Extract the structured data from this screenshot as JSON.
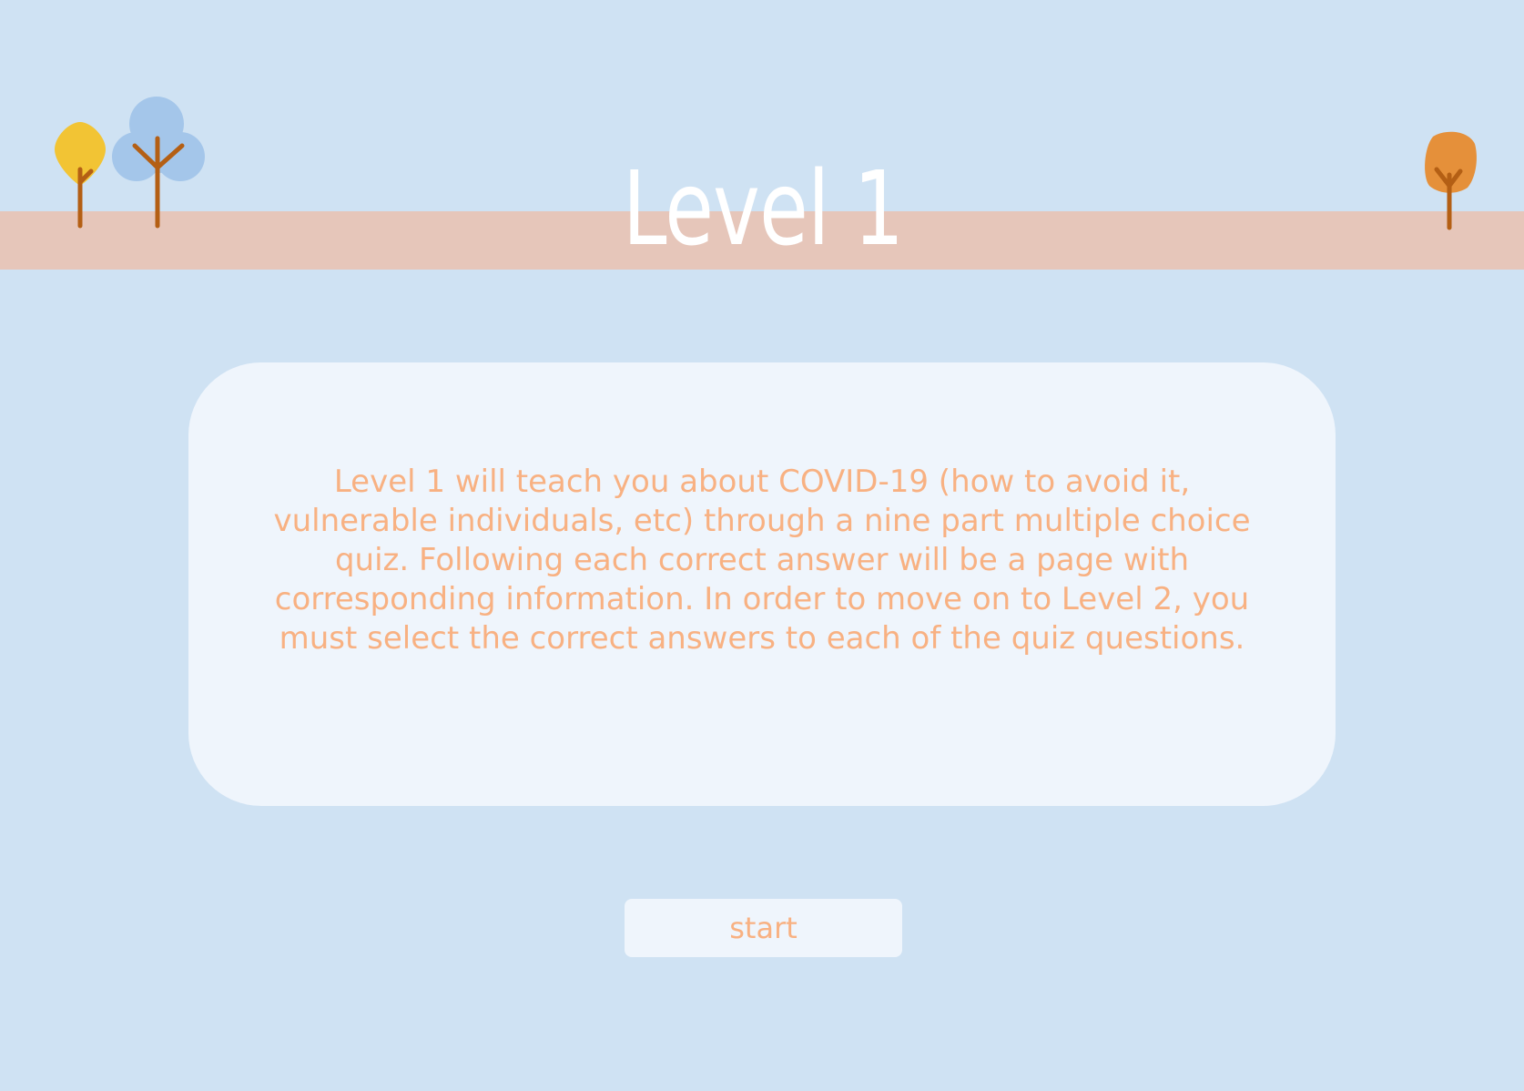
{
  "level": {
    "title": "Level 1",
    "description": "Level 1 will teach you about COVID-19 (how to avoid it, vulnerable individuals, etc) through a nine part multiple choice quiz. Following each correct answer will be a page with corresponding information. In order to move on to Level 2, you must select the correct answers to each of the quiz questions.",
    "start_label": "start"
  },
  "icons": [
    "yellow-tree-icon",
    "blue-tree-icon",
    "orange-tree-icon"
  ],
  "colors": {
    "background": "#cfe2f3",
    "band": "#e6c6ba",
    "title_text": "#ffffff",
    "card": "#eff5fc",
    "accent_text": "#f8b182",
    "tree_yellow": "#f2c434",
    "tree_blue": "#a4c6ea",
    "tree_orange": "#e5903a",
    "trunk": "#b45f14"
  }
}
